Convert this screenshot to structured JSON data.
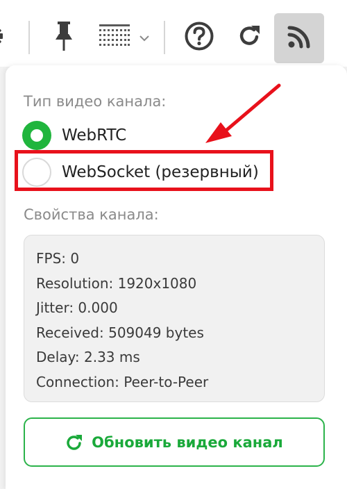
{
  "toolbar": {
    "items": [
      "gear-icon",
      "pin-icon",
      "grid-icon",
      "chevron-down-icon",
      "help-icon",
      "refresh-icon",
      "rss-icon"
    ]
  },
  "popup": {
    "channel_type_title": "Тип видео канала:",
    "options": [
      {
        "label": "WebRTC",
        "checked": true
      },
      {
        "label": "WebSocket (резервный)",
        "checked": false
      }
    ],
    "properties_title": "Свойства канала:",
    "properties": [
      "FPS: 0",
      "Resolution: 1920x1080",
      "Jitter: 0.000",
      "Received: 509049 bytes",
      "Delay: 2.33 ms",
      "Connection: Peer-to-Peer"
    ],
    "refresh_button_label": "Обновить видео канал"
  },
  "colors": {
    "accent_green": "#20b53d",
    "annotation_red": "#e8111b",
    "toolbar_icon": "#3d3d3d",
    "active_button_bg": "#d4d4d4"
  }
}
